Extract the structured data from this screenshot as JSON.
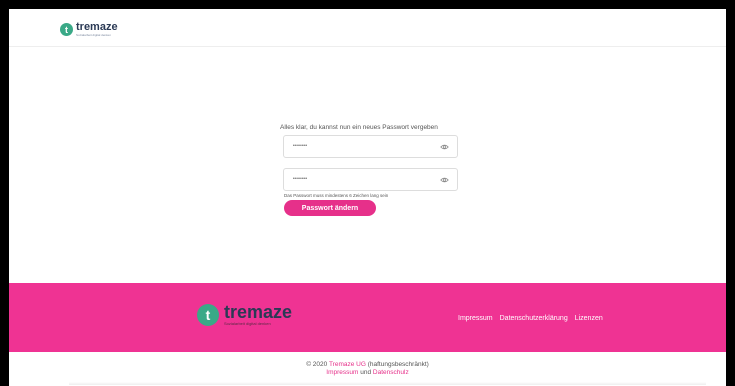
{
  "brand": {
    "name": "tremaze",
    "tagline": "Sozialarbeit digital denken",
    "mark": "t",
    "colors": {
      "accent": "#e6308a",
      "footer": "#ef3393",
      "logo_green": "#3aa987",
      "logo_text": "#2b3a55"
    }
  },
  "form": {
    "prompt": "Alles klar, du kannst nun ein neues Passwort vergeben",
    "password_1": "•••••••",
    "password_2": "•••••••",
    "toggle_icon": "eye-icon",
    "hint": "Das Passwort muss mindestens 6 Zeichen lang sein",
    "submit_label": "Passwort ändern"
  },
  "footer": {
    "links": [
      "Impressum",
      "Datenschutzerklärung",
      "Lizenzen"
    ]
  },
  "bottom": {
    "copyright_prefix": "© 2020 ",
    "company": "Tremaze UG",
    "copyright_suffix": " (haftungsbeschränkt)",
    "legal_link_1": "Impressum",
    "legal_joiner": " und ",
    "legal_link_2": "Datenschulz"
  }
}
